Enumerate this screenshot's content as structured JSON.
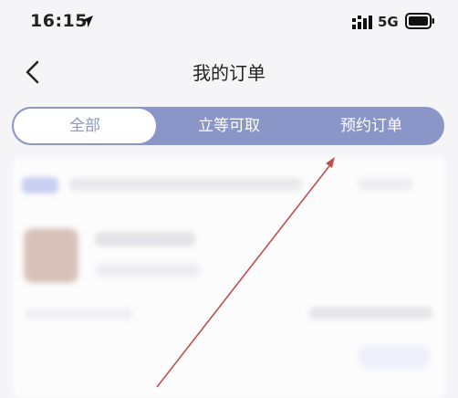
{
  "status_bar": {
    "time": "16:15",
    "network": "5G",
    "icons": [
      "location-arrow-icon",
      "signal-icon",
      "battery-icon"
    ]
  },
  "nav": {
    "title": "我的订单",
    "back_icon": "chevron-left-icon"
  },
  "tabs": [
    {
      "label": "全部",
      "selected": true
    },
    {
      "label": "立等可取",
      "selected": false
    },
    {
      "label": "预约订单",
      "selected": false
    }
  ],
  "colors": {
    "accent": "#8a95c8",
    "annotation_arrow": "#c0504d",
    "background": "#f5f5f7"
  }
}
